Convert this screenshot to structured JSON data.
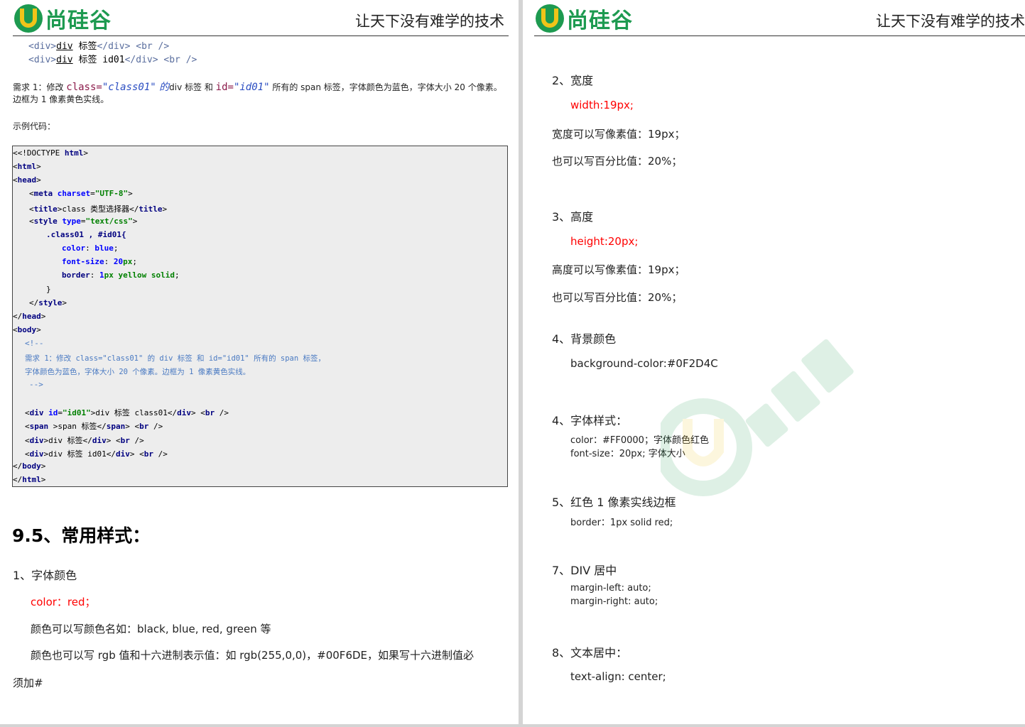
{
  "header": {
    "logo_text": "尚硅谷",
    "slogan": "让天下没有难学的技术"
  },
  "left": {
    "top_code": [
      {
        "open": "<div>",
        "tagname": "div",
        "text": " 标签",
        "close": "</div>",
        "br": " <br />"
      },
      {
        "open": "<div>",
        "tagname": "div",
        "text": " 标签 id01",
        "close": "</div>",
        "br": " <br />"
      }
    ],
    "req": {
      "prefix": "需求 1：修改 ",
      "class_kw": "class=",
      "class_val": "\"class01\"",
      "de": " 的",
      "middle": "div 标签 和 ",
      "id_kw": "id=",
      "id_val": "\"id01\"",
      "suffix": " 所有的 span 标签，字体颜色为蓝色，字体大小 20 个像素。",
      "line2": "边框为 1 像素黄色实线。"
    },
    "example_label": "示例代码：",
    "code": {
      "doctype": "<!DOCTYPE ",
      "html": "html",
      "html_tag": "html",
      "head_tag": "head",
      "meta_tag": "meta",
      "charset_attr": "charset",
      "charset_val": "\"UTF-8\"",
      "title_tag": "title",
      "title_text": "class 类型选择器",
      "style_tag": "style",
      "type_attr": "type",
      "type_val": "\"text/css\"",
      "selector": ".class01 , #id01{",
      "color_prop": "color",
      "color_val": "blue",
      "fs_prop": "font-size",
      "fs_num": "20",
      "fs_unit": "px",
      "border_prop": "border",
      "border_num": "1",
      "border_rest": "px yellow solid",
      "brace": "}",
      "body_tag": "body",
      "comment_open": "<!--",
      "comment_1": "需求 1：修改 class=\"class01\" 的 div 标签 和 id=\"id01\" 所有的 span 标签，",
      "comment_2": "字体颜色为蓝色，字体大小 20 个像素。边框为 1 像素黄色实线。",
      "comment_close": "-->",
      "div_tag": "div",
      "id_attr": "id",
      "id_val": "\"id01\"",
      "div_text_1": "div 标签 class01",
      "span_tag": "span",
      "span_text": ">span 标签",
      "div_text_2": "div 标签",
      "div_text_3": "div 标签 id01",
      "br_tag": "br"
    },
    "section_title": "9.5、常用样式：",
    "item1_title": "1、字体颜色",
    "item1_code": "color：red；",
    "item1_line1": "颜色可以写颜色名如：black, blue, red, green 等",
    "item1_line2": "颜色也可以写 rgb 值和十六进制表示值：如 rgb(255,0,0)，#00F6DE，如果写十六进制值必",
    "item1_line3": "须加#"
  },
  "right": {
    "item2_title": "2、宽度",
    "item2_code": "width:19px;",
    "item2_line1": "宽度可以写像素值：19px；",
    "item2_line2": "也可以写百分比值：20%；",
    "item3_title": "3、高度",
    "item3_code": "height:20px;",
    "item3_line1": "高度可以写像素值：19px；",
    "item3_line2": "也可以写百分比值：20%；",
    "item4_title": "4、背景颜色",
    "item4_code": "background-color:#0F2D4C",
    "item4b_title": "4、字体样式：",
    "item4b_line1": "color：#FF0000；字体颜色红色",
    "item4b_line2": "font-size：20px; 字体大小",
    "item5_title": "5、红色 1 像素实线边框",
    "item5_code": "border：1px solid red;",
    "item7_title": "7、DIV 居中",
    "item7_line1": "margin-left: auto;",
    "item7_line2": "margin-right: auto;",
    "item8_title": "8、文本居中：",
    "item8_code": "text-align: center;"
  },
  "colors": {
    "brand_green": "#1d9a50",
    "brand_yellow": "#f0c419",
    "red_text": "#ff0000",
    "tag_navy": "#000080",
    "attr_blue": "#0000ff",
    "string_green": "#008000",
    "comment_blue": "#4a7ac2",
    "code_bg": "#ededed"
  }
}
